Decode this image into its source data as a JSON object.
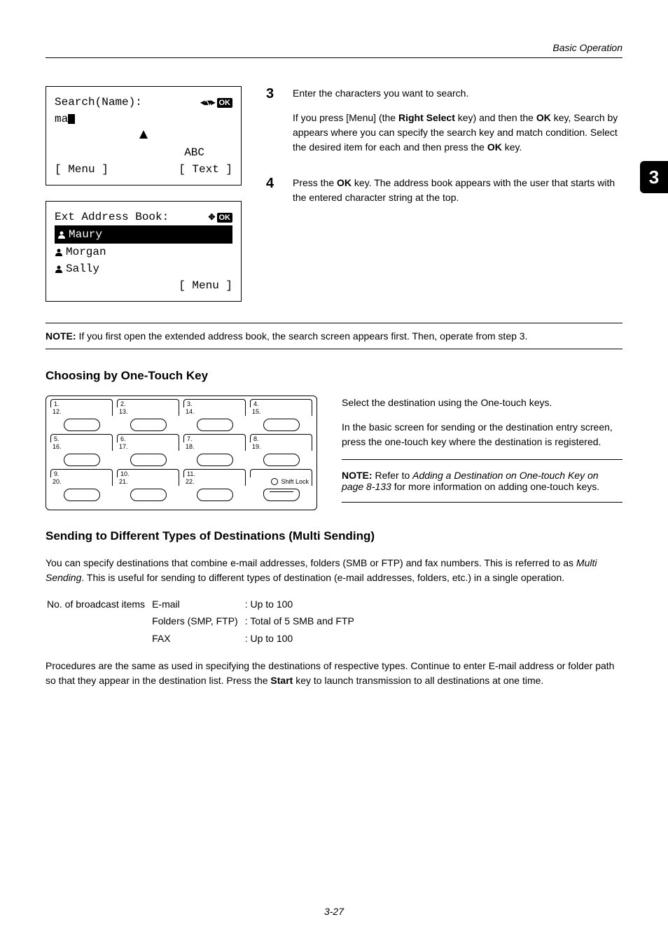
{
  "header": {
    "title": "Basic Operation"
  },
  "side_tab": "3",
  "lcd1": {
    "title": "Search(Name):",
    "input_prefix": "ma",
    "mode": "ABC",
    "left_soft": "[  Menu  ]",
    "right_soft": "[  Text  ]"
  },
  "lcd2": {
    "title": "Ext Address Book:",
    "items": [
      "Maury",
      "Morgan",
      "Sally"
    ],
    "right_soft": "[  Menu  ]"
  },
  "steps": {
    "s3": {
      "num": "3",
      "p1": "Enter the characters you want to search.",
      "p2": "If you press [Menu] (the Right Select key) and then the OK key, Search by appears where you can specify the search key and match condition. Select the desired item for each and then press the OK key."
    },
    "s4": {
      "num": "4",
      "p1": "Press the OK key. The address book appears with the user that starts with the entered character string at the top."
    }
  },
  "note1": "NOTE: If you first open the extended address book, the search screen appears first. Then, operate from step 3.",
  "section1": {
    "heading": "Choosing by One-Touch Key",
    "p1": "Select the destination using the One-touch keys.",
    "p2": "In the basic screen for sending or the destination entry screen, press the one-touch key where the destination is registered.",
    "note": "NOTE: Refer to Adding a Destination on One-touch Key on page 8-133 for more information on adding one-touch keys."
  },
  "onetouch": {
    "rows": [
      {
        "tops": [
          "1.",
          "2.",
          "3.",
          "4."
        ],
        "bottoms": [
          "12.",
          "13.",
          "14.",
          "15."
        ],
        "special": null
      },
      {
        "tops": [
          "5.",
          "6.",
          "7.",
          "8."
        ],
        "bottoms": [
          "16.",
          "17.",
          "18.",
          "19."
        ],
        "special": null
      },
      {
        "tops": [
          "9.",
          "10.",
          "11.",
          ""
        ],
        "bottoms": [
          "20.",
          "21.",
          "22.",
          "Shift Lock"
        ],
        "special": "shift"
      }
    ]
  },
  "section2": {
    "heading": "Sending to Different Types of Destinations (Multi Sending)",
    "p1": "You can specify destinations that combine e-mail addresses, folders (SMB or FTP) and fax numbers. This is referred to as Multi Sending. This is useful for sending to different types of destination (e-mail addresses, folders, etc.) in a single operation.",
    "broadcast_label": "No. of broadcast items",
    "lines": [
      {
        "k": "E-mail",
        "v": ": Up to 100"
      },
      {
        "k": "Folders (SMP, FTP)",
        "v": ": Total of 5 SMB and FTP"
      },
      {
        "k": "FAX",
        "v": ": Up to 100"
      }
    ],
    "p2": "Procedures are the same as used in specifying the destinations of respective types. Continue to enter E-mail address or folder path so that they appear in the destination list. Press the Start key to launch transmission to all destinations at one time."
  },
  "footer": "3-27"
}
